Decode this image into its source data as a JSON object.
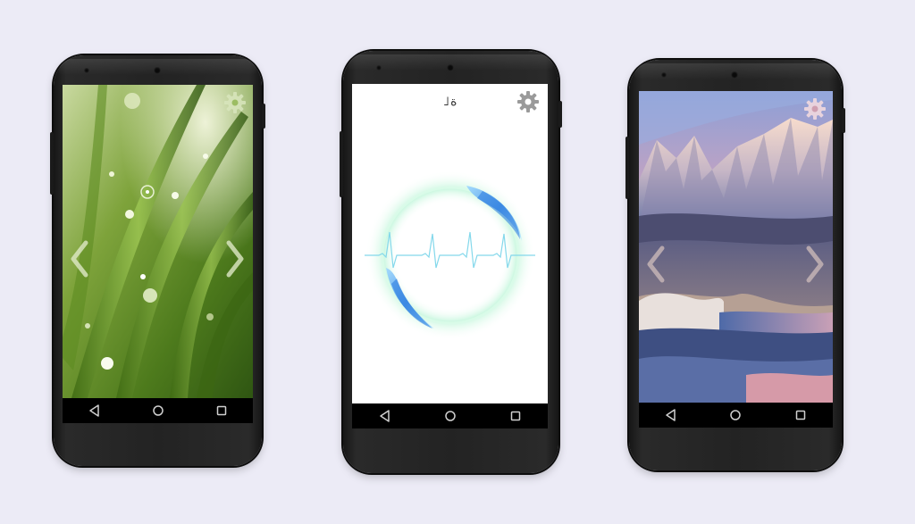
{
  "phones": [
    {
      "name": "phone-left",
      "wallpaper": "green-grass-dewdrops",
      "buttons": [
        "back",
        "home",
        "recents"
      ]
    },
    {
      "name": "phone-center",
      "title": "˩ة",
      "visual": "heartbeat-ring",
      "buttons": [
        "back",
        "home",
        "recents"
      ]
    },
    {
      "name": "phone-right",
      "wallpaper": "mountain-lake-sunset",
      "buttons": [
        "back",
        "home",
        "recents"
      ]
    }
  ],
  "icons": {
    "settings": "gear-icon",
    "prev": "chevron-left-icon",
    "next": "chevron-right-icon",
    "back": "back-triangle-icon",
    "home": "home-circle-icon",
    "recents": "recents-square-icon"
  },
  "colors": {
    "background": "#ecebf6",
    "phone_body": "#232323",
    "navbar": "#000000",
    "pulse": "#6fd3e8",
    "ring_glow": "#bff5e0"
  }
}
